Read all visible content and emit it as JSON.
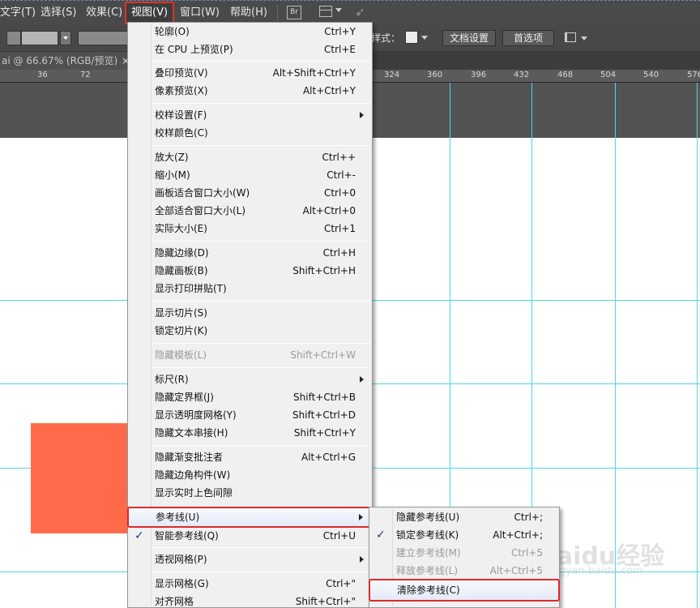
{
  "menubar": {
    "items": [
      {
        "label": "文字(T)"
      },
      {
        "label": "选择(S)"
      },
      {
        "label": "效果(C)"
      },
      {
        "label": "视图(V)"
      },
      {
        "label": "窗口(W)"
      },
      {
        "label": "帮助(H)"
      }
    ],
    "bridge_label": "Br"
  },
  "control_bar": {
    "style_label": "样式：",
    "doc_settings": "文档设置",
    "preferences": "首选项"
  },
  "document_tab": {
    "title": "ai @ 66.67% (RGB/预览)",
    "close": "×"
  },
  "ruler": {
    "ticks": [
      "36",
      "72",
      "324",
      "360",
      "396",
      "432",
      "468",
      "504",
      "540",
      "576"
    ]
  },
  "view_menu": {
    "items": [
      {
        "label": "轮廓(O)",
        "shortcut": "Ctrl+Y"
      },
      {
        "label": "在 CPU 上预览(P)",
        "shortcut": "Ctrl+E"
      },
      {
        "label": "叠印预览(V)",
        "shortcut": "Alt+Shift+Ctrl+Y"
      },
      {
        "label": "像素预览(X)",
        "shortcut": "Alt+Ctrl+Y"
      },
      {
        "label": "校样设置(F)",
        "shortcut": ""
      },
      {
        "label": "校样颜色(C)",
        "shortcut": ""
      },
      {
        "label": "放大(Z)",
        "shortcut": "Ctrl++"
      },
      {
        "label": "缩小(M)",
        "shortcut": "Ctrl+-"
      },
      {
        "label": "画板适合窗口大小(W)",
        "shortcut": "Ctrl+0"
      },
      {
        "label": "全部适合窗口大小(L)",
        "shortcut": "Alt+Ctrl+0"
      },
      {
        "label": "实际大小(E)",
        "shortcut": "Ctrl+1"
      },
      {
        "label": "隐藏边缘(D)",
        "shortcut": "Ctrl+H"
      },
      {
        "label": "隐藏画板(B)",
        "shortcut": "Shift+Ctrl+H"
      },
      {
        "label": "显示打印拼贴(T)",
        "shortcut": ""
      },
      {
        "label": "显示切片(S)",
        "shortcut": ""
      },
      {
        "label": "锁定切片(K)",
        "shortcut": ""
      },
      {
        "label": "隐藏模板(L)",
        "shortcut": "Shift+Ctrl+W"
      },
      {
        "label": "标尺(R)",
        "shortcut": ""
      },
      {
        "label": "隐藏定界框(J)",
        "shortcut": "Shift+Ctrl+B"
      },
      {
        "label": "显示透明度网格(Y)",
        "shortcut": "Shift+Ctrl+D"
      },
      {
        "label": "隐藏文本串接(H)",
        "shortcut": "Shift+Ctrl+Y"
      },
      {
        "label": "隐藏渐变批注者",
        "shortcut": "Alt+Ctrl+G"
      },
      {
        "label": "隐藏边角构件(W)",
        "shortcut": ""
      },
      {
        "label": "显示实时上色间隙",
        "shortcut": ""
      },
      {
        "label": "参考线(U)",
        "shortcut": ""
      },
      {
        "label": "智能参考线(Q)",
        "shortcut": "Ctrl+U"
      },
      {
        "label": "透视网格(P)",
        "shortcut": ""
      },
      {
        "label": "显示网格(G)",
        "shortcut": "Ctrl+\""
      },
      {
        "label": "对齐网格",
        "shortcut": "Shift+Ctrl+\""
      }
    ],
    "check_mark": "✓"
  },
  "guides_submenu": {
    "items": [
      {
        "label": "隐藏参考线(U)",
        "shortcut": "Ctrl+;"
      },
      {
        "label": "锁定参考线(K)",
        "shortcut": "Alt+Ctrl+;"
      },
      {
        "label": "建立参考线(M)",
        "shortcut": "Ctrl+5"
      },
      {
        "label": "释放参考线(L)",
        "shortcut": "Alt+Ctrl+5"
      },
      {
        "label": "清除参考线(C)",
        "shortcut": ""
      }
    ],
    "check_mark": "✓"
  },
  "watermark": {
    "text": "Baidu经验",
    "sub": "jingyan.baidu.com"
  },
  "colors": {
    "highlight_red": "#e02828",
    "guide_cyan": "#4fd6e6",
    "shape_fill": "#ff6b4a"
  }
}
